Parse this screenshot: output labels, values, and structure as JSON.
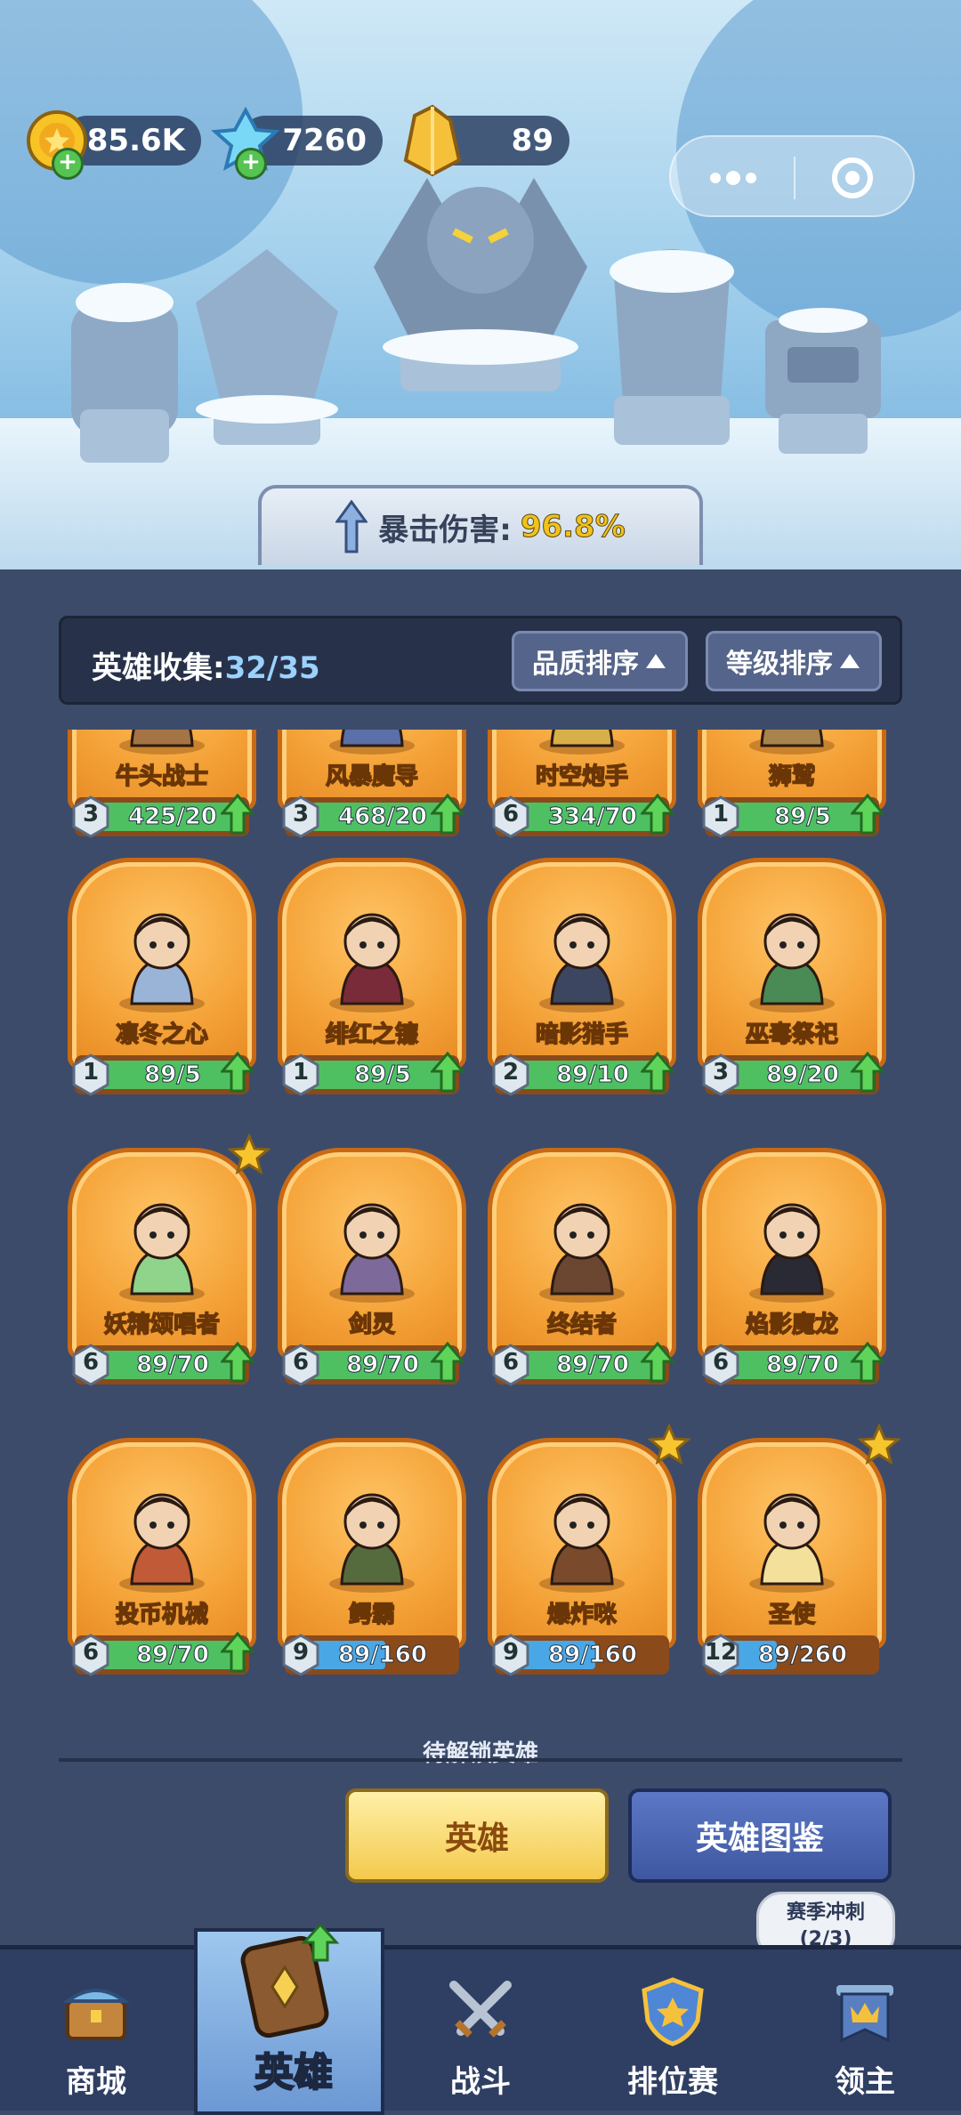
{
  "resources": {
    "gold": "85.6K",
    "gems": "7260",
    "crystals": "89"
  },
  "crit": {
    "label": "暴击伤害:",
    "value": "96.8%"
  },
  "collection": {
    "label": "英雄收集:",
    "count": "32/35"
  },
  "sort": {
    "quality": "品质排序",
    "level": "等级排序"
  },
  "cards": [
    {
      "name": "牛头战士",
      "level": "3",
      "progress": "425/20",
      "fill": 1.0,
      "color": "green",
      "up": true,
      "star": false,
      "icon": "minotaur-icon"
    },
    {
      "name": "风暴魔导",
      "level": "3",
      "progress": "468/20",
      "fill": 1.0,
      "color": "green",
      "up": true,
      "star": false,
      "icon": "storm-mage-icon"
    },
    {
      "name": "时空炮手",
      "level": "6",
      "progress": "334/70",
      "fill": 1.0,
      "color": "green",
      "up": true,
      "star": false,
      "icon": "gunner-icon"
    },
    {
      "name": "狮鹫",
      "level": "1",
      "progress": "89/5",
      "fill": 1.0,
      "color": "green",
      "up": true,
      "star": false,
      "icon": "griffin-icon"
    },
    {
      "name": "凛冬之心",
      "level": "1",
      "progress": "89/5",
      "fill": 1.0,
      "color": "green",
      "up": true,
      "star": false,
      "icon": "ice-queen-icon"
    },
    {
      "name": "绯红之镰",
      "level": "1",
      "progress": "89/5",
      "fill": 1.0,
      "color": "green",
      "up": true,
      "star": false,
      "icon": "crimson-scythe-icon"
    },
    {
      "name": "暗影猎手",
      "level": "2",
      "progress": "89/10",
      "fill": 1.0,
      "color": "green",
      "up": true,
      "star": false,
      "icon": "shadow-hunter-icon"
    },
    {
      "name": "巫毒祭祀",
      "level": "3",
      "progress": "89/20",
      "fill": 1.0,
      "color": "green",
      "up": true,
      "star": false,
      "icon": "voodoo-priestess-icon"
    },
    {
      "name": "妖精颂唱者",
      "level": "6",
      "progress": "89/70",
      "fill": 1.0,
      "color": "green",
      "up": true,
      "star": true,
      "icon": "fairy-icon"
    },
    {
      "name": "剑灵",
      "level": "6",
      "progress": "89/70",
      "fill": 1.0,
      "color": "green",
      "up": true,
      "star": false,
      "icon": "sword-spirit-icon"
    },
    {
      "name": "终结者",
      "level": "6",
      "progress": "89/70",
      "fill": 1.0,
      "color": "green",
      "up": true,
      "star": false,
      "icon": "terminator-icon"
    },
    {
      "name": "焰影魔龙",
      "level": "6",
      "progress": "89/70",
      "fill": 1.0,
      "color": "green",
      "up": true,
      "star": false,
      "icon": "shadow-dragon-icon"
    },
    {
      "name": "投币机械",
      "level": "6",
      "progress": "89/70",
      "fill": 1.0,
      "color": "green",
      "up": true,
      "star": false,
      "icon": "slot-machine-icon"
    },
    {
      "name": "鳄霸",
      "level": "9",
      "progress": "89/160",
      "fill": 0.556,
      "color": "blue",
      "up": false,
      "star": false,
      "icon": "croc-icon"
    },
    {
      "name": "爆炸咪",
      "level": "9",
      "progress": "89/160",
      "fill": 0.556,
      "color": "blue",
      "up": false,
      "star": true,
      "icon": "cat-girl-icon"
    },
    {
      "name": "圣使",
      "level": "12",
      "progress": "89/260",
      "fill": 0.342,
      "color": "blue",
      "up": false,
      "star": true,
      "icon": "angel-icon"
    }
  ],
  "pending_label": "待解锁英雄",
  "buttons": {
    "hero": "英雄",
    "dex": "英雄图鉴"
  },
  "bubble": {
    "line1": "赛季冲刺",
    "line2": "(2/3)"
  },
  "nav": [
    {
      "label": "商城",
      "icon": "chest-icon"
    },
    {
      "label": "英雄",
      "icon": "hero-card-icon"
    },
    {
      "label": "战斗",
      "icon": "crossed-swords-icon"
    },
    {
      "label": "排位赛",
      "icon": "ranked-shield-icon"
    },
    {
      "label": "领主",
      "icon": "castle-banner-icon"
    }
  ],
  "colors": {
    "accent": "#f2c21b",
    "card_orange": "#f5a53b",
    "bar_green": "#4fc062",
    "bar_blue": "#4aa7e6",
    "nav_bg": "#2f3f63"
  }
}
